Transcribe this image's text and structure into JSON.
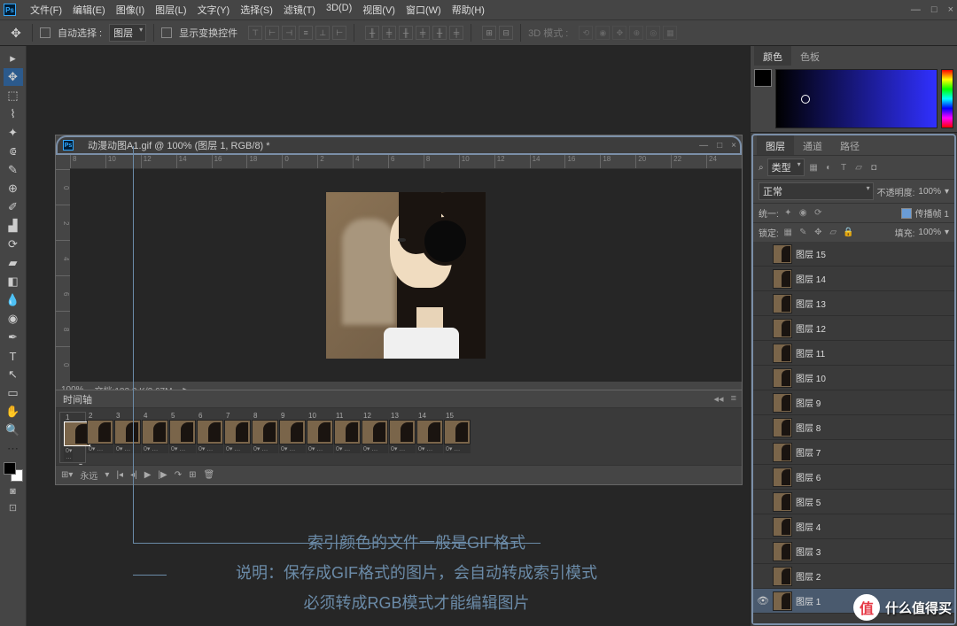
{
  "menu": [
    "文件(F)",
    "编辑(E)",
    "图像(I)",
    "图层(L)",
    "文字(Y)",
    "选择(S)",
    "滤镜(T)",
    "3D(D)",
    "视图(V)",
    "窗口(W)",
    "帮助(H)"
  ],
  "optbar": {
    "auto": "自动选择 :",
    "layer": "图层",
    "show": "显示变换控件",
    "mode3d": "3D 模式 :"
  },
  "doc": {
    "title": "动漫动图A1.gif @ 100% (图层 1, RGB/8) *",
    "zoom": "100%",
    "info": "文档:182.3 K/2.67M"
  },
  "rulerH": [
    "8",
    "10",
    "12",
    "14",
    "16",
    "18",
    "0",
    "2",
    "4",
    "6",
    "8",
    "10",
    "12",
    "14",
    "16",
    "18",
    "20",
    "22",
    "24"
  ],
  "rulerV": [
    "0",
    "2",
    "4",
    "6",
    "8",
    "0"
  ],
  "timeline": {
    "title": "时间轴",
    "loop": "永远",
    "frames": [
      {
        "n": "1",
        "t": "0▾"
      },
      {
        "n": "2",
        "t": "0▾"
      },
      {
        "n": "3",
        "t": "0▾"
      },
      {
        "n": "4",
        "t": "0▾"
      },
      {
        "n": "5",
        "t": "0▾"
      },
      {
        "n": "6",
        "t": "0▾"
      },
      {
        "n": "7",
        "t": "0▾"
      },
      {
        "n": "8",
        "t": "0▾"
      },
      {
        "n": "9",
        "t": "0▾"
      },
      {
        "n": "10",
        "t": "0▾"
      },
      {
        "n": "11",
        "t": "0▾"
      },
      {
        "n": "12",
        "t": "0▾"
      },
      {
        "n": "13",
        "t": "0▾"
      },
      {
        "n": "14",
        "t": "0▾"
      },
      {
        "n": "15",
        "t": "0▾"
      }
    ]
  },
  "ann": {
    "l1": "索引颜色的文件一般是GIF格式",
    "l2": "说明：保存成GIF格式的图片，会自动转成索引模式",
    "l3": "必须转成RGB模式才能编辑图片"
  },
  "panels": {
    "color": "颜色",
    "swatch": "色板",
    "layers": "图层",
    "channels": "通道",
    "paths": "路径"
  },
  "lp": {
    "kind": "类型",
    "normal": "正常",
    "opacity_l": "不透明度:",
    "opacity_v": "100%",
    "unify": "统一:",
    "propagate": "传播帧 1",
    "lock": "锁定:",
    "fill_l": "填充:",
    "fill_v": "100%"
  },
  "layers": [
    {
      "name": "图层 15",
      "vis": false
    },
    {
      "name": "图层 14",
      "vis": false
    },
    {
      "name": "图层 13",
      "vis": false
    },
    {
      "name": "图层 12",
      "vis": false
    },
    {
      "name": "图层 11",
      "vis": false
    },
    {
      "name": "图层 10",
      "vis": false
    },
    {
      "name": "图层 9",
      "vis": false
    },
    {
      "name": "图层 8",
      "vis": false
    },
    {
      "name": "图层 7",
      "vis": false
    },
    {
      "name": "图层 6",
      "vis": false
    },
    {
      "name": "图层 5",
      "vis": false
    },
    {
      "name": "图层 4",
      "vis": false
    },
    {
      "name": "图层 3",
      "vis": false
    },
    {
      "name": "图层 2",
      "vis": false
    },
    {
      "name": "图层 1",
      "vis": true,
      "active": true
    }
  ],
  "wm": {
    "icon": "值",
    "text": "什么值得买"
  }
}
